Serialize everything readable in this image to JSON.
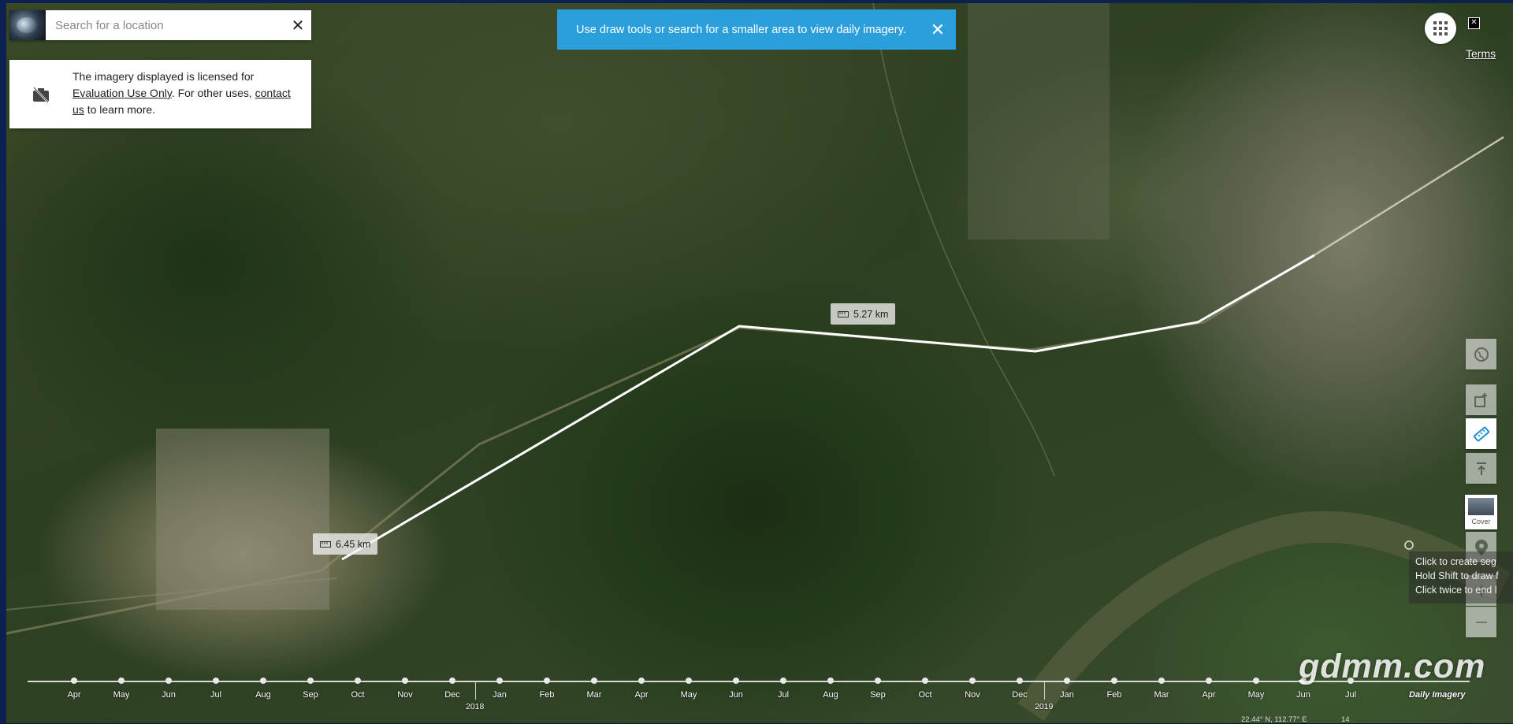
{
  "search": {
    "placeholder": "Search for a location",
    "clear_icon": "close-icon"
  },
  "license": {
    "icon": "no-camera-icon",
    "text_1": "The imagery displayed is licensed for",
    "link_1": "Evaluation Use Only",
    "text_2": ". For other uses,",
    "link_2": "contact us",
    "text_3": "to learn more."
  },
  "banner": {
    "message": "Use draw tools or search for a smaller area to view daily imagery.",
    "close_icon": "close-icon"
  },
  "top_right": {
    "apps_icon": "grid-icon",
    "terms": "Terms"
  },
  "measurements": [
    {
      "label": "5.27 km"
    },
    {
      "label": "6.45 km"
    }
  ],
  "tools": {
    "cover_label": "Cover"
  },
  "hint": {
    "line1": "Click to create seg",
    "line2": "Hold Shift to draw f",
    "line3": "Click twice to end l"
  },
  "timeline": {
    "months": [
      "Apr",
      "May",
      "Jun",
      "Jul",
      "Aug",
      "Sep",
      "Oct",
      "Nov",
      "Dec",
      "Jan",
      "Feb",
      "Mar",
      "Apr",
      "May",
      "Jun",
      "Jul",
      "Aug",
      "Sep",
      "Oct",
      "Nov",
      "Dec",
      "Jan",
      "Feb",
      "Mar",
      "Apr",
      "May",
      "Jun",
      "Jul"
    ],
    "years": [
      "2018",
      "2019"
    ]
  },
  "watermark": "gdmm.com",
  "daily_label": "Daily Imagery",
  "status": {
    "coords": "22.44° N, 112.77° E",
    "zoom": "14"
  },
  "colors": {
    "banner": "#2a9fdc",
    "route": "#ffffff"
  }
}
